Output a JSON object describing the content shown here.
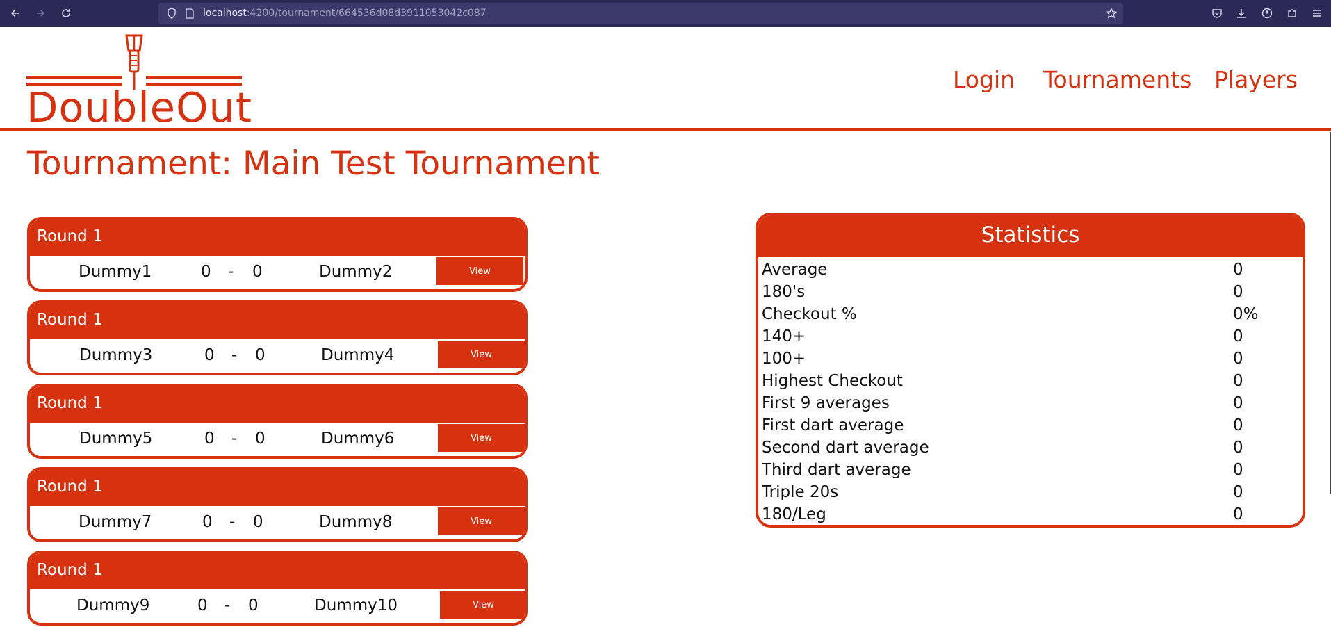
{
  "browser": {
    "url_host": "localhost",
    "url_path": ":4200/tournament/664536d08d3911053042c087"
  },
  "brand": {
    "logo_text": "DoubleOut"
  },
  "nav": {
    "login": "Login",
    "tournaments": "Tournaments",
    "players": "Players"
  },
  "page": {
    "title": "Tournament: Main Test Tournament"
  },
  "matches": [
    {
      "round": "Round 1",
      "player1": "Dummy1",
      "score1": "0",
      "separator": "-",
      "score2": "0",
      "player2": "Dummy2",
      "view_label": "View"
    },
    {
      "round": "Round 1",
      "player1": "Dummy3",
      "score1": "0",
      "separator": "-",
      "score2": "0",
      "player2": "Dummy4",
      "view_label": "View"
    },
    {
      "round": "Round 1",
      "player1": "Dummy5",
      "score1": "0",
      "separator": "-",
      "score2": "0",
      "player2": "Dummy6",
      "view_label": "View"
    },
    {
      "round": "Round 1",
      "player1": "Dummy7",
      "score1": "0",
      "separator": "-",
      "score2": "0",
      "player2": "Dummy8",
      "view_label": "View"
    },
    {
      "round": "Round 1",
      "player1": "Dummy9",
      "score1": "0",
      "separator": "-",
      "score2": "0",
      "player2": "Dummy10",
      "view_label": "View"
    }
  ],
  "statistics": {
    "title": "Statistics",
    "rows": [
      {
        "label": "Average",
        "value": "0"
      },
      {
        "label": "180's",
        "value": "0"
      },
      {
        "label": "Checkout %",
        "value": "0%"
      },
      {
        "label": "140+",
        "value": "0"
      },
      {
        "label": "100+",
        "value": "0"
      },
      {
        "label": "Highest Checkout",
        "value": "0"
      },
      {
        "label": "First 9 averages",
        "value": "0"
      },
      {
        "label": "First dart average",
        "value": "0"
      },
      {
        "label": "Second dart average",
        "value": "0"
      },
      {
        "label": "Third dart average",
        "value": "0"
      },
      {
        "label": "Triple 20s",
        "value": "0"
      },
      {
        "label": "180/Leg",
        "value": "0"
      }
    ]
  },
  "colors": {
    "accent": "#d7320f",
    "chrome": "#2b2a56",
    "urlbar": "#3b3a6a"
  },
  "icons": [
    "back-icon",
    "forward-icon",
    "reload-icon",
    "shield-icon",
    "page-icon",
    "star-icon",
    "pocket-icon",
    "download-icon",
    "account-icon",
    "extensions-icon",
    "menu-icon",
    "dart-icon"
  ]
}
